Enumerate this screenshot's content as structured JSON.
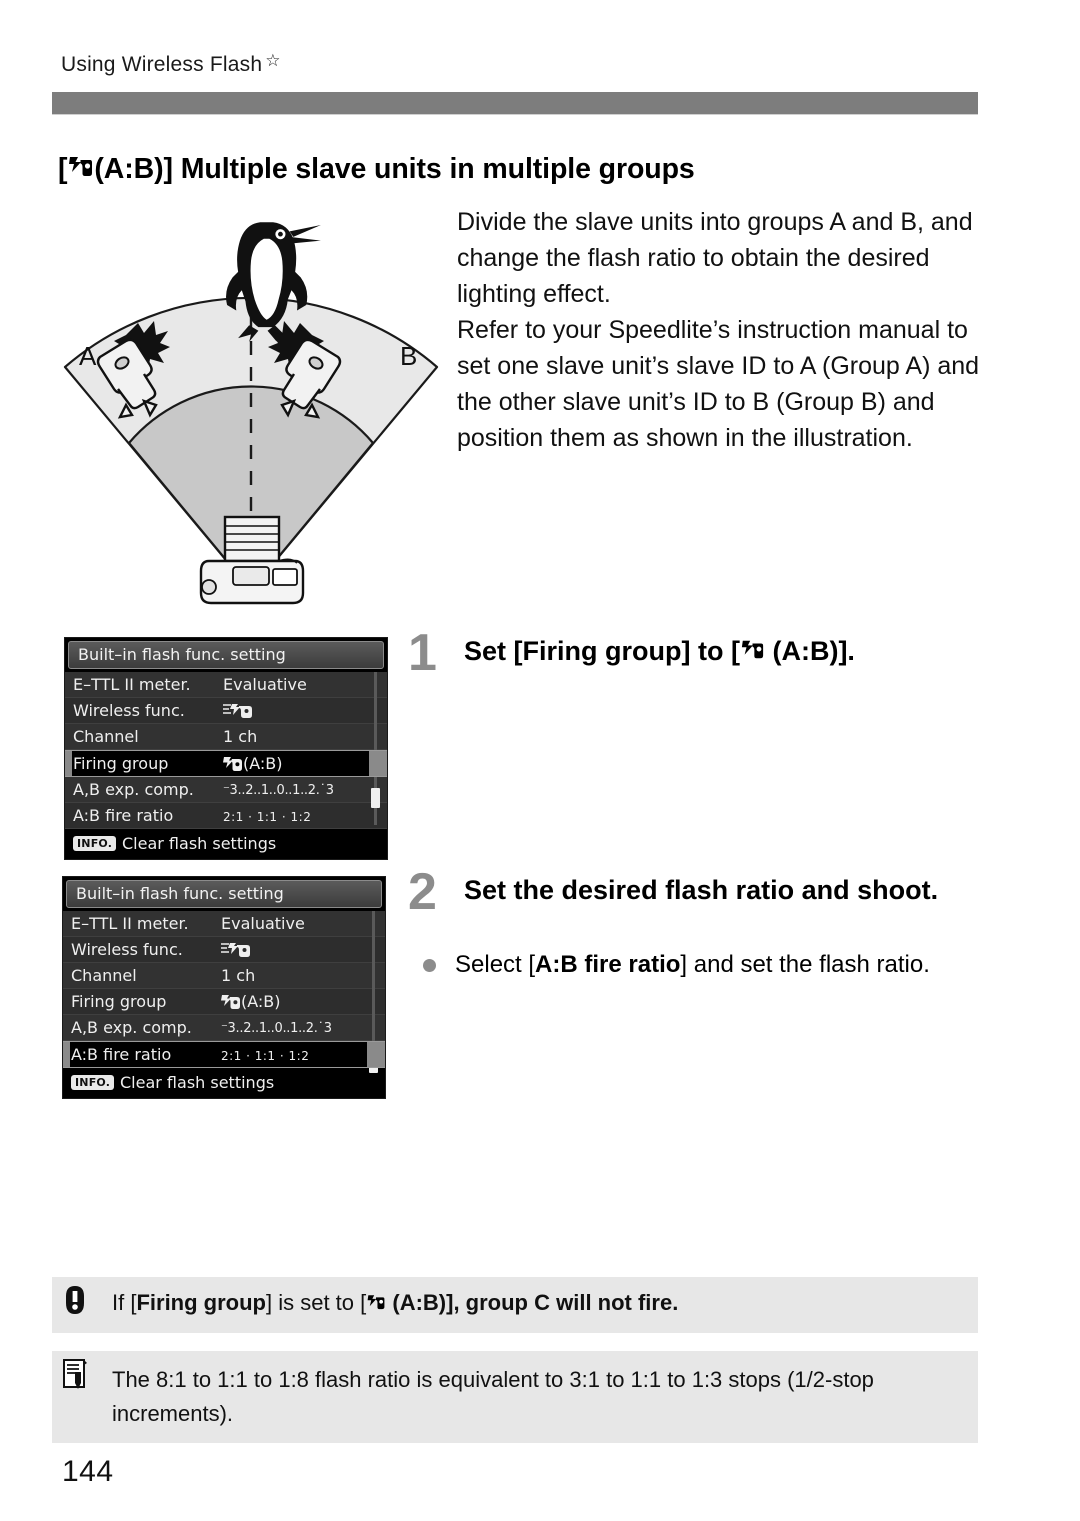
{
  "running_head": {
    "text": "Using Wireless Flash",
    "star": "☆"
  },
  "section": {
    "heading_prefix": "[",
    "heading_mid": "(A:B)] Multiple slave units in multiple groups",
    "flash_icon": "wireless-flash-icon"
  },
  "illustration": {
    "name": "wireless-flash-setup-diagram",
    "label_a": "A",
    "label_b": "B",
    "subject": "penguin",
    "devices": [
      "speedlite-a",
      "speedlite-b",
      "camera-body"
    ]
  },
  "intro": {
    "paragraph_1": "Divide the slave units into groups A and B, and change the flash ratio to obtain the desired lighting effect.",
    "paragraph_2": "Refer to your Speedlite’s instruction manual to set one slave unit’s slave ID to A (Group A) and the other slave unit’s ID to B (Group B) and position them as shown in the illustration."
  },
  "menu": {
    "title": "Built–in flash func. setting",
    "footer_badge": "INFO.",
    "footer_text": "Clear flash settings",
    "rows": [
      {
        "label": "E–TTL II meter.",
        "value": "Evaluative",
        "value_kind": "text"
      },
      {
        "label": "Wireless func.",
        "value": "",
        "value_kind": "wireless-icon"
      },
      {
        "label": "Channel",
        "value": "1   ch",
        "value_kind": "text"
      },
      {
        "label": "Firing group",
        "value": "(A:B)",
        "value_kind": "group-icon"
      },
      {
        "label": "A,B exp. comp.",
        "value": "⁻3..2..1..0..1..2.˙3",
        "value_kind": "scale"
      },
      {
        "label": "A:B fire ratio",
        "value": "2:1   ·   1:1   ·   1:2",
        "value_kind": "ratio"
      }
    ],
    "shot_one": {
      "selected_index": 3,
      "caption": "menu-firing-group-selected"
    },
    "shot_two": {
      "selected_index": 5,
      "caption": "menu-fire-ratio-selected"
    }
  },
  "steps": [
    {
      "number": "1",
      "headline_prefix": "Set [Firing group] to [",
      "headline_suffix": "(A:B)]."
    },
    {
      "number": "2",
      "headline": "Set the desired flash ratio and shoot.",
      "bullet_prefix": "Select [",
      "bullet_bold": "A:B fire ratio",
      "bullet_suffix": "] and set the flash ratio."
    }
  ],
  "notes": [
    {
      "icon": "caution-icon",
      "prefix": "If [",
      "bold_1": "Firing group",
      "mid": "] is set to [",
      "suffix": "(A:B)], group C will not fire."
    },
    {
      "icon": "note-pencil-icon",
      "text": "The 8:1 to 1:1 to 1:8 flash ratio is equivalent to 3:1 to 1:1 to 1:3 stops (1/2-stop increments)."
    }
  ],
  "page_number": "144",
  "colors": {
    "rule_gray": "#7d7d7d",
    "note_bg": "#e7e7e7",
    "step_num_gray": "#8c8c8c",
    "menu_bg": "#2b2b2b"
  }
}
